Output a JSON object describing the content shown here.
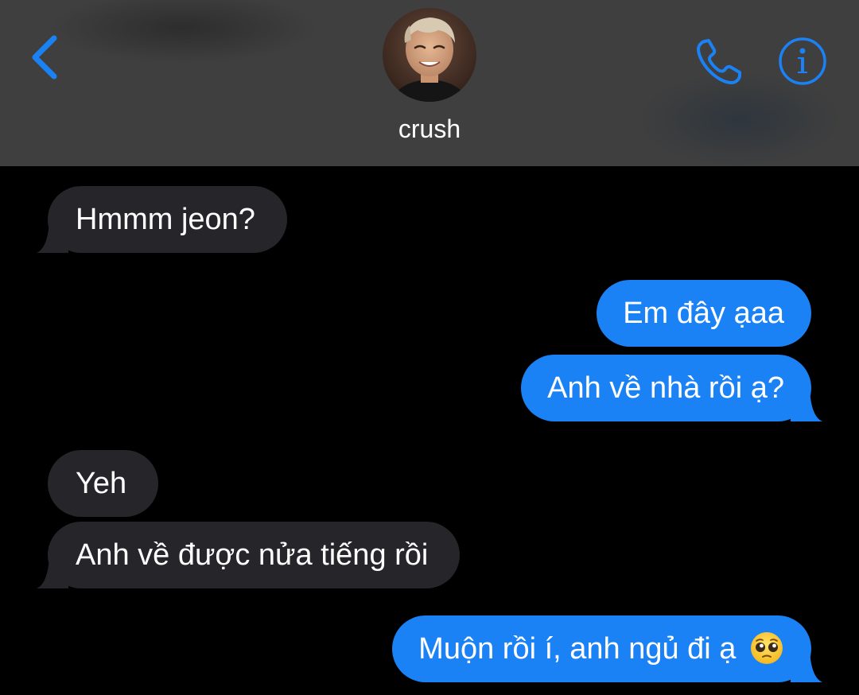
{
  "header": {
    "contact_name": "crush",
    "avatar_icon": "avatar",
    "back_icon": "chevron-left-icon",
    "phone_icon": "phone-icon",
    "info_icon": "info-icon",
    "accent_color": "#1b82f5",
    "background_color": "#3f3f3f"
  },
  "messages": [
    {
      "direction": "incoming",
      "text": "Hmmm jeon?"
    },
    {
      "direction": "outgoing",
      "text": "Em đây ạaa"
    },
    {
      "direction": "outgoing",
      "text": "Anh về nhà rồi ạ?"
    },
    {
      "direction": "incoming",
      "text": "Yeh"
    },
    {
      "direction": "incoming",
      "text": "Anh về được nửa tiếng rồi"
    },
    {
      "direction": "outgoing",
      "text": "Muộn rồi í, anh ngủ đi ạ",
      "emoji": "pleading-face-emoji"
    }
  ],
  "colors": {
    "incoming_bubble": "#262529",
    "outgoing_bubble": "#1b82f5",
    "chat_background": "#000000",
    "text": "#ffffff"
  }
}
